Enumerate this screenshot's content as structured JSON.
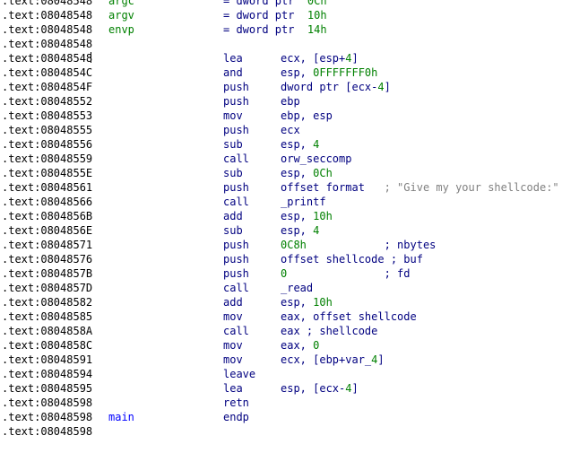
{
  "listing": [
    {
      "addr": ".text:08048548",
      "name": "argc",
      "name_color": "green",
      "mnem": "",
      "ops": [
        {
          "t": "= dword ptr  ",
          "c": "sym"
        },
        {
          "t": "0Ch",
          "c": "num"
        }
      ]
    },
    {
      "addr": ".text:08048548",
      "name": "argv",
      "name_color": "green",
      "mnem": "",
      "ops": [
        {
          "t": "= dword ptr  ",
          "c": "sym"
        },
        {
          "t": "10h",
          "c": "num"
        }
      ]
    },
    {
      "addr": ".text:08048548",
      "name": "envp",
      "name_color": "green",
      "mnem": "",
      "ops": [
        {
          "t": "= dword ptr  ",
          "c": "sym"
        },
        {
          "t": "14h",
          "c": "num"
        }
      ]
    },
    {
      "addr": ".text:08048548",
      "name": "",
      "mnem": "",
      "ops": []
    },
    {
      "addr": ".text:08048548",
      "name": "",
      "mnem": "lea",
      "ops": [
        {
          "t": "ecx, [esp+",
          "c": "sym"
        },
        {
          "t": "4",
          "c": "num"
        },
        {
          "t": "]",
          "c": "sym"
        }
      ]
    },
    {
      "addr": ".text:0804854C",
      "name": "",
      "mnem": "and",
      "ops": [
        {
          "t": "esp, ",
          "c": "sym"
        },
        {
          "t": "0FFFFFFF0h",
          "c": "num"
        }
      ]
    },
    {
      "addr": ".text:0804854F",
      "name": "",
      "mnem": "push",
      "ops": [
        {
          "t": "dword ptr [ecx-",
          "c": "sym"
        },
        {
          "t": "4",
          "c": "num"
        },
        {
          "t": "]",
          "c": "sym"
        }
      ]
    },
    {
      "addr": ".text:08048552",
      "name": "",
      "mnem": "push",
      "ops": [
        {
          "t": "ebp",
          "c": "sym"
        }
      ]
    },
    {
      "addr": ".text:08048553",
      "name": "",
      "mnem": "mov",
      "ops": [
        {
          "t": "ebp, esp",
          "c": "sym"
        }
      ]
    },
    {
      "addr": ".text:08048555",
      "name": "",
      "mnem": "push",
      "ops": [
        {
          "t": "ecx",
          "c": "sym"
        }
      ]
    },
    {
      "addr": ".text:08048556",
      "name": "",
      "mnem": "sub",
      "ops": [
        {
          "t": "esp, ",
          "c": "sym"
        },
        {
          "t": "4",
          "c": "num"
        }
      ]
    },
    {
      "addr": ".text:08048559",
      "name": "",
      "mnem": "call",
      "ops": [
        {
          "t": "orw_seccomp",
          "c": "sym"
        }
      ]
    },
    {
      "addr": ".text:0804855E",
      "name": "",
      "mnem": "sub",
      "ops": [
        {
          "t": "esp, ",
          "c": "sym"
        },
        {
          "t": "0Ch",
          "c": "num"
        }
      ]
    },
    {
      "addr": ".text:08048561",
      "name": "",
      "mnem": "push",
      "ops": [
        {
          "t": "offset format   ",
          "c": "sym"
        },
        {
          "t": "; \"Give my your shellcode:\"",
          "c": "cmt"
        }
      ]
    },
    {
      "addr": ".text:08048566",
      "name": "",
      "mnem": "call",
      "ops": [
        {
          "t": "_printf",
          "c": "sym"
        }
      ]
    },
    {
      "addr": ".text:0804856B",
      "name": "",
      "mnem": "add",
      "ops": [
        {
          "t": "esp, ",
          "c": "sym"
        },
        {
          "t": "10h",
          "c": "num"
        }
      ]
    },
    {
      "addr": ".text:0804856E",
      "name": "",
      "mnem": "sub",
      "ops": [
        {
          "t": "esp, ",
          "c": "sym"
        },
        {
          "t": "4",
          "c": "num"
        }
      ]
    },
    {
      "addr": ".text:08048571",
      "name": "",
      "mnem": "push",
      "ops": [
        {
          "t": "0C8h",
          "c": "num"
        },
        {
          "t": "            ; nbytes",
          "c": "sym"
        }
      ]
    },
    {
      "addr": ".text:08048576",
      "name": "",
      "mnem": "push",
      "ops": [
        {
          "t": "offset shellcode ; buf",
          "c": "sym"
        }
      ]
    },
    {
      "addr": ".text:0804857B",
      "name": "",
      "mnem": "push",
      "ops": [
        {
          "t": "0",
          "c": "num"
        },
        {
          "t": "               ; fd",
          "c": "sym"
        }
      ]
    },
    {
      "addr": ".text:0804857D",
      "name": "",
      "mnem": "call",
      "ops": [
        {
          "t": "_read",
          "c": "sym"
        }
      ]
    },
    {
      "addr": ".text:08048582",
      "name": "",
      "mnem": "add",
      "ops": [
        {
          "t": "esp, ",
          "c": "sym"
        },
        {
          "t": "10h",
          "c": "num"
        }
      ]
    },
    {
      "addr": ".text:08048585",
      "name": "",
      "mnem": "mov",
      "ops": [
        {
          "t": "eax, offset shellcode",
          "c": "sym"
        }
      ]
    },
    {
      "addr": ".text:0804858A",
      "name": "",
      "mnem": "call",
      "ops": [
        {
          "t": "eax ; shellcode",
          "c": "sym"
        }
      ]
    },
    {
      "addr": ".text:0804858C",
      "name": "",
      "mnem": "mov",
      "ops": [
        {
          "t": "eax, ",
          "c": "sym"
        },
        {
          "t": "0",
          "c": "num"
        }
      ]
    },
    {
      "addr": ".text:08048591",
      "name": "",
      "mnem": "mov",
      "ops": [
        {
          "t": "ecx, [ebp+var_",
          "c": "sym"
        },
        {
          "t": "4",
          "c": "num"
        },
        {
          "t": "]",
          "c": "sym"
        }
      ]
    },
    {
      "addr": ".text:08048594",
      "name": "",
      "mnem": "leave",
      "ops": []
    },
    {
      "addr": ".text:08048595",
      "name": "",
      "mnem": "lea",
      "ops": [
        {
          "t": "esp, [ecx-",
          "c": "sym"
        },
        {
          "t": "4",
          "c": "num"
        },
        {
          "t": "]",
          "c": "sym"
        }
      ]
    },
    {
      "addr": ".text:08048598",
      "name": "",
      "mnem": "retn",
      "ops": []
    },
    {
      "addr": ".text:08048598",
      "name": "main",
      "name_color": "blue",
      "mnem": "endp",
      "ops": []
    },
    {
      "addr": ".text:08048598",
      "name": "",
      "mnem": "",
      "ops": []
    }
  ]
}
